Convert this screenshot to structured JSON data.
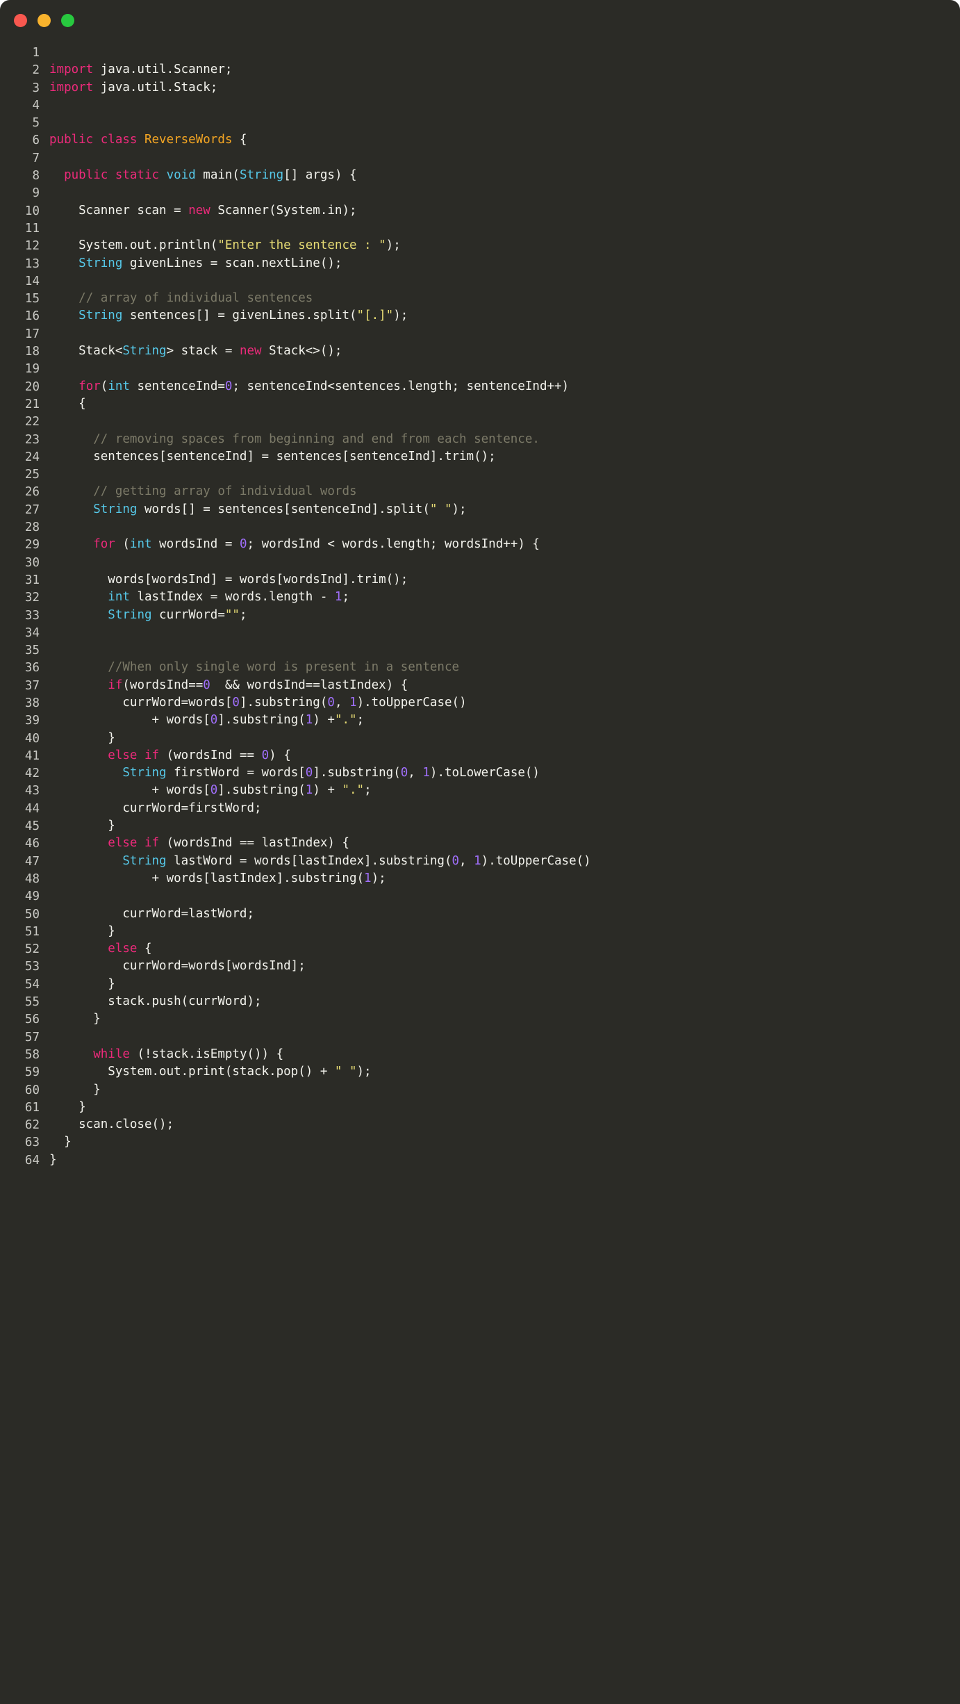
{
  "window": {
    "traffic_lights": [
      {
        "name": "close-button",
        "color": "#f9584f"
      },
      {
        "name": "minimize-button",
        "color": "#f9b32d"
      },
      {
        "name": "maximize-button",
        "color": "#28c93f"
      }
    ],
    "background": "#2b2b26"
  },
  "theme": {
    "keyword": "#ed2a7b",
    "type": "#56c8e8",
    "class_name": "#f5a623",
    "string": "#e6db74",
    "comment": "#7c7a68",
    "number": "#a06ffb",
    "plain": "#f2f2ec",
    "line_number": "#c9c9c4"
  },
  "code": {
    "language": "java",
    "lines": [
      {
        "num": "1",
        "tokens": []
      },
      {
        "num": "2",
        "tokens": [
          {
            "t": "import",
            "c": "k"
          },
          {
            "t": " java.util.Scanner;",
            "c": "p"
          }
        ]
      },
      {
        "num": "3",
        "tokens": [
          {
            "t": "import",
            "c": "k"
          },
          {
            "t": " java.util.Stack;",
            "c": "p"
          }
        ]
      },
      {
        "num": "4",
        "tokens": []
      },
      {
        "num": "5",
        "tokens": []
      },
      {
        "num": "6",
        "tokens": [
          {
            "t": "public class ",
            "c": "k"
          },
          {
            "t": "ReverseWords",
            "c": "cl"
          },
          {
            "t": " {",
            "c": "p"
          }
        ]
      },
      {
        "num": "7",
        "tokens": []
      },
      {
        "num": "8",
        "tokens": [
          {
            "t": "  ",
            "c": "p"
          },
          {
            "t": "public static ",
            "c": "k"
          },
          {
            "t": "void",
            "c": "t"
          },
          {
            "t": " main(",
            "c": "p"
          },
          {
            "t": "String",
            "c": "t"
          },
          {
            "t": "[] args) {",
            "c": "p"
          }
        ]
      },
      {
        "num": "9",
        "tokens": []
      },
      {
        "num": "10",
        "tokens": [
          {
            "t": "    Scanner scan = ",
            "c": "p"
          },
          {
            "t": "new",
            "c": "k"
          },
          {
            "t": " Scanner(System.in);",
            "c": "p"
          }
        ]
      },
      {
        "num": "11",
        "tokens": []
      },
      {
        "num": "12",
        "tokens": [
          {
            "t": "    System.out.println(",
            "c": "p"
          },
          {
            "t": "\"Enter the sentence : \"",
            "c": "s"
          },
          {
            "t": ");",
            "c": "p"
          }
        ]
      },
      {
        "num": "13",
        "tokens": [
          {
            "t": "    ",
            "c": "p"
          },
          {
            "t": "String",
            "c": "t"
          },
          {
            "t": " givenLines = scan.nextLine();",
            "c": "p"
          }
        ]
      },
      {
        "num": "14",
        "tokens": []
      },
      {
        "num": "15",
        "tokens": [
          {
            "t": "    ",
            "c": "p"
          },
          {
            "t": "// array of individual sentences",
            "c": "c"
          }
        ]
      },
      {
        "num": "16",
        "tokens": [
          {
            "t": "    ",
            "c": "p"
          },
          {
            "t": "String",
            "c": "t"
          },
          {
            "t": " sentences[] = givenLines.split(",
            "c": "p"
          },
          {
            "t": "\"[.]\"",
            "c": "s"
          },
          {
            "t": ");",
            "c": "p"
          }
        ]
      },
      {
        "num": "17",
        "tokens": []
      },
      {
        "num": "18",
        "tokens": [
          {
            "t": "    Stack<",
            "c": "p"
          },
          {
            "t": "String",
            "c": "t"
          },
          {
            "t": "> stack = ",
            "c": "p"
          },
          {
            "t": "new",
            "c": "k"
          },
          {
            "t": " Stack<>();",
            "c": "p"
          }
        ]
      },
      {
        "num": "19",
        "tokens": []
      },
      {
        "num": "20",
        "tokens": [
          {
            "t": "    ",
            "c": "p"
          },
          {
            "t": "for",
            "c": "k"
          },
          {
            "t": "(",
            "c": "p"
          },
          {
            "t": "int",
            "c": "t"
          },
          {
            "t": " sentenceInd=",
            "c": "p"
          },
          {
            "t": "0",
            "c": "n"
          },
          {
            "t": "; sentenceInd<sentences.length; sentenceInd++)",
            "c": "p"
          }
        ]
      },
      {
        "num": "21",
        "tokens": [
          {
            "t": "    {",
            "c": "p"
          }
        ]
      },
      {
        "num": "22",
        "tokens": []
      },
      {
        "num": "23",
        "tokens": [
          {
            "t": "      ",
            "c": "p"
          },
          {
            "t": "// removing spaces from beginning and end from each sentence.",
            "c": "c"
          }
        ]
      },
      {
        "num": "24",
        "tokens": [
          {
            "t": "      sentences[sentenceInd] = sentences[sentenceInd].trim();",
            "c": "p"
          }
        ]
      },
      {
        "num": "25",
        "tokens": []
      },
      {
        "num": "26",
        "tokens": [
          {
            "t": "      ",
            "c": "p"
          },
          {
            "t": "// getting array of individual words",
            "c": "c"
          }
        ]
      },
      {
        "num": "27",
        "tokens": [
          {
            "t": "      ",
            "c": "p"
          },
          {
            "t": "String",
            "c": "t"
          },
          {
            "t": " words[] = sentences[sentenceInd].split(",
            "c": "p"
          },
          {
            "t": "\" \"",
            "c": "s"
          },
          {
            "t": ");",
            "c": "p"
          }
        ]
      },
      {
        "num": "28",
        "tokens": []
      },
      {
        "num": "29",
        "tokens": [
          {
            "t": "      ",
            "c": "p"
          },
          {
            "t": "for",
            "c": "k"
          },
          {
            "t": " (",
            "c": "p"
          },
          {
            "t": "int",
            "c": "t"
          },
          {
            "t": " wordsInd = ",
            "c": "p"
          },
          {
            "t": "0",
            "c": "n"
          },
          {
            "t": "; wordsInd < words.length; wordsInd++) {",
            "c": "p"
          }
        ]
      },
      {
        "num": "30",
        "tokens": []
      },
      {
        "num": "31",
        "tokens": [
          {
            "t": "        words[wordsInd] = words[wordsInd].trim();",
            "c": "p"
          }
        ]
      },
      {
        "num": "32",
        "tokens": [
          {
            "t": "        ",
            "c": "p"
          },
          {
            "t": "int",
            "c": "t"
          },
          {
            "t": " lastIndex = words.length - ",
            "c": "p"
          },
          {
            "t": "1",
            "c": "n"
          },
          {
            "t": ";",
            "c": "p"
          }
        ]
      },
      {
        "num": "33",
        "tokens": [
          {
            "t": "        ",
            "c": "p"
          },
          {
            "t": "String",
            "c": "t"
          },
          {
            "t": " currWord=",
            "c": "p"
          },
          {
            "t": "\"\"",
            "c": "s"
          },
          {
            "t": ";",
            "c": "p"
          }
        ]
      },
      {
        "num": "34",
        "tokens": []
      },
      {
        "num": "35",
        "tokens": []
      },
      {
        "num": "36",
        "tokens": [
          {
            "t": "        ",
            "c": "p"
          },
          {
            "t": "//When only single word is present in a sentence",
            "c": "c"
          }
        ]
      },
      {
        "num": "37",
        "tokens": [
          {
            "t": "        ",
            "c": "p"
          },
          {
            "t": "if",
            "c": "k"
          },
          {
            "t": "(wordsInd==",
            "c": "p"
          },
          {
            "t": "0",
            "c": "n"
          },
          {
            "t": "  && wordsInd==lastIndex) {",
            "c": "p"
          }
        ]
      },
      {
        "num": "38",
        "tokens": [
          {
            "t": "          currWord=words[",
            "c": "p"
          },
          {
            "t": "0",
            "c": "n"
          },
          {
            "t": "].substring(",
            "c": "p"
          },
          {
            "t": "0",
            "c": "n"
          },
          {
            "t": ", ",
            "c": "p"
          },
          {
            "t": "1",
            "c": "n"
          },
          {
            "t": ").toUpperCase()",
            "c": "p"
          }
        ]
      },
      {
        "num": "39",
        "tokens": [
          {
            "t": "              + words[",
            "c": "p"
          },
          {
            "t": "0",
            "c": "n"
          },
          {
            "t": "].substring(",
            "c": "p"
          },
          {
            "t": "1",
            "c": "n"
          },
          {
            "t": ") +",
            "c": "p"
          },
          {
            "t": "\".\"",
            "c": "s"
          },
          {
            "t": ";",
            "c": "p"
          }
        ]
      },
      {
        "num": "40",
        "tokens": [
          {
            "t": "        }",
            "c": "p"
          }
        ]
      },
      {
        "num": "41",
        "tokens": [
          {
            "t": "        ",
            "c": "p"
          },
          {
            "t": "else if",
            "c": "k"
          },
          {
            "t": " (wordsInd == ",
            "c": "p"
          },
          {
            "t": "0",
            "c": "n"
          },
          {
            "t": ") {",
            "c": "p"
          }
        ]
      },
      {
        "num": "42",
        "tokens": [
          {
            "t": "          ",
            "c": "p"
          },
          {
            "t": "String",
            "c": "t"
          },
          {
            "t": " firstWord = words[",
            "c": "p"
          },
          {
            "t": "0",
            "c": "n"
          },
          {
            "t": "].substring(",
            "c": "p"
          },
          {
            "t": "0",
            "c": "n"
          },
          {
            "t": ", ",
            "c": "p"
          },
          {
            "t": "1",
            "c": "n"
          },
          {
            "t": ").toLowerCase()",
            "c": "p"
          }
        ]
      },
      {
        "num": "43",
        "tokens": [
          {
            "t": "              + words[",
            "c": "p"
          },
          {
            "t": "0",
            "c": "n"
          },
          {
            "t": "].substring(",
            "c": "p"
          },
          {
            "t": "1",
            "c": "n"
          },
          {
            "t": ") + ",
            "c": "p"
          },
          {
            "t": "\".\"",
            "c": "s"
          },
          {
            "t": ";",
            "c": "p"
          }
        ]
      },
      {
        "num": "44",
        "tokens": [
          {
            "t": "          currWord=firstWord;",
            "c": "p"
          }
        ]
      },
      {
        "num": "45",
        "tokens": [
          {
            "t": "        }",
            "c": "p"
          }
        ]
      },
      {
        "num": "46",
        "tokens": [
          {
            "t": "        ",
            "c": "p"
          },
          {
            "t": "else if",
            "c": "k"
          },
          {
            "t": " (wordsInd == lastIndex) {",
            "c": "p"
          }
        ]
      },
      {
        "num": "47",
        "tokens": [
          {
            "t": "          ",
            "c": "p"
          },
          {
            "t": "String",
            "c": "t"
          },
          {
            "t": " lastWord = words[lastIndex].substring(",
            "c": "p"
          },
          {
            "t": "0",
            "c": "n"
          },
          {
            "t": ", ",
            "c": "p"
          },
          {
            "t": "1",
            "c": "n"
          },
          {
            "t": ").toUpperCase()",
            "c": "p"
          }
        ]
      },
      {
        "num": "48",
        "tokens": [
          {
            "t": "              + words[lastIndex].substring(",
            "c": "p"
          },
          {
            "t": "1",
            "c": "n"
          },
          {
            "t": ");",
            "c": "p"
          }
        ]
      },
      {
        "num": "49",
        "tokens": []
      },
      {
        "num": "50",
        "tokens": [
          {
            "t": "          currWord=lastWord;",
            "c": "p"
          }
        ]
      },
      {
        "num": "51",
        "tokens": [
          {
            "t": "        }",
            "c": "p"
          }
        ]
      },
      {
        "num": "52",
        "tokens": [
          {
            "t": "        ",
            "c": "p"
          },
          {
            "t": "else",
            "c": "k"
          },
          {
            "t": " {",
            "c": "p"
          }
        ]
      },
      {
        "num": "53",
        "tokens": [
          {
            "t": "          currWord=words[wordsInd];",
            "c": "p"
          }
        ]
      },
      {
        "num": "54",
        "tokens": [
          {
            "t": "        }",
            "c": "p"
          }
        ]
      },
      {
        "num": "55",
        "tokens": [
          {
            "t": "        stack.push(currWord);",
            "c": "p"
          }
        ]
      },
      {
        "num": "56",
        "tokens": [
          {
            "t": "      }",
            "c": "p"
          }
        ]
      },
      {
        "num": "57",
        "tokens": []
      },
      {
        "num": "58",
        "tokens": [
          {
            "t": "      ",
            "c": "p"
          },
          {
            "t": "while",
            "c": "k"
          },
          {
            "t": " (!stack.isEmpty()) {",
            "c": "p"
          }
        ]
      },
      {
        "num": "59",
        "tokens": [
          {
            "t": "        System.out.print(stack.pop() + ",
            "c": "p"
          },
          {
            "t": "\" \"",
            "c": "s"
          },
          {
            "t": ");",
            "c": "p"
          }
        ]
      },
      {
        "num": "60",
        "tokens": [
          {
            "t": "      }",
            "c": "p"
          }
        ]
      },
      {
        "num": "61",
        "tokens": [
          {
            "t": "    }",
            "c": "p"
          }
        ]
      },
      {
        "num": "62",
        "tokens": [
          {
            "t": "    scan.close();",
            "c": "p"
          }
        ]
      },
      {
        "num": "63",
        "tokens": [
          {
            "t": "  }",
            "c": "p"
          }
        ]
      },
      {
        "num": "64",
        "tokens": [
          {
            "t": "}",
            "c": "p"
          }
        ]
      }
    ]
  }
}
